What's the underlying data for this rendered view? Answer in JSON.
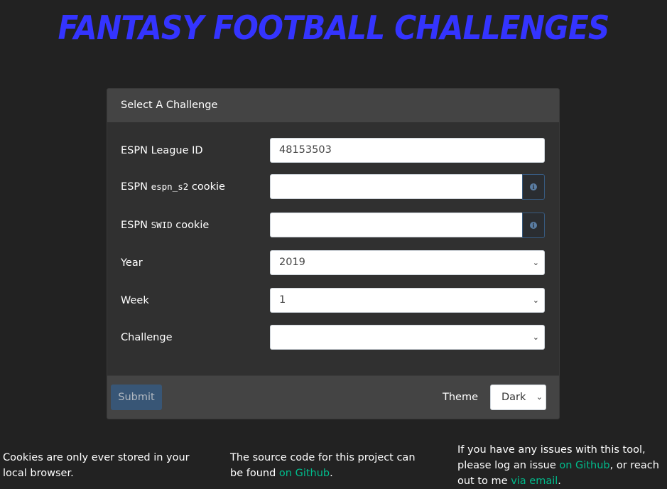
{
  "header": {
    "title": "Fantasy Football Challenges"
  },
  "form": {
    "card_title": "Select A Challenge",
    "league_id": {
      "label": "ESPN League ID",
      "value": "48153503"
    },
    "espn_s2": {
      "label_prefix": "ESPN",
      "label_code": "espn_s2",
      "label_suffix": "cookie",
      "value": "",
      "info_icon": "info-icon"
    },
    "swid": {
      "label_prefix": "ESPN",
      "label_code": "SWID",
      "label_suffix": "cookie",
      "value": "",
      "info_icon": "info-icon"
    },
    "year": {
      "label": "Year",
      "selected": "2019"
    },
    "week": {
      "label": "Week",
      "selected": "1"
    },
    "challenge": {
      "label": "Challenge",
      "selected": ""
    }
  },
  "footer_bar": {
    "submit_label": "Submit",
    "theme_label": "Theme",
    "theme_selected": "Dark"
  },
  "footnotes": {
    "cookies_text": "Cookies are only ever stored in your local browser.",
    "source_text": "The source code for this project can be found",
    "source_link": "on Github",
    "source_end": ".",
    "issues_text1": "If you have any issues with this tool, please log an issue",
    "issues_link1": "on Github",
    "issues_text2": ", or reach out to me",
    "issues_link2": "via email",
    "issues_end": "."
  },
  "colors": {
    "title": "#3434ff",
    "accent": "#375a7f",
    "link": "#00bc8c",
    "background": "#222222"
  }
}
